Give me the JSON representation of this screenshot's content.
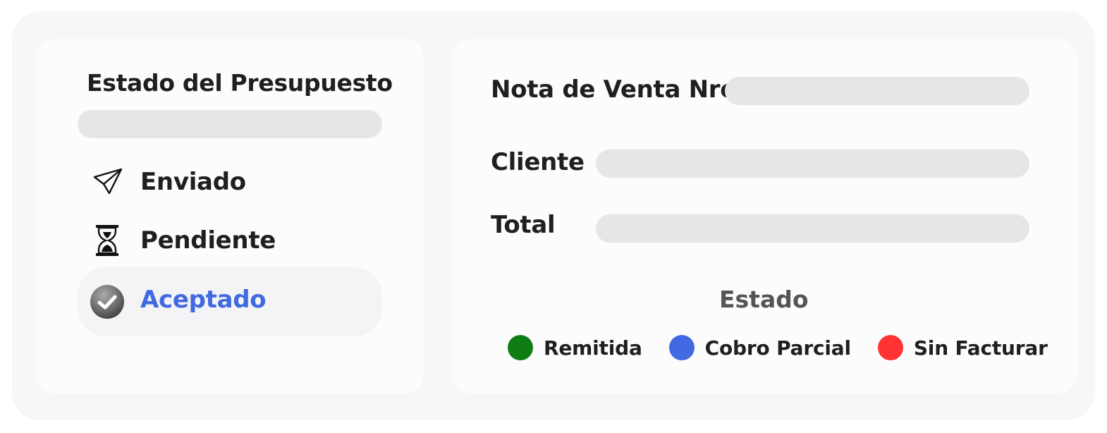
{
  "presupuesto": {
    "title": "Estado del Presupuesto",
    "statuses": [
      {
        "label": "Enviado",
        "icon": "paper-plane-icon"
      },
      {
        "label": "Pendiente",
        "icon": "hourglass-icon"
      },
      {
        "label": "Aceptado",
        "icon": "check-circle-icon",
        "active": true
      }
    ]
  },
  "venta": {
    "nota_label": "Nota de Venta Nro.",
    "nota_value": "",
    "cliente_label": "Cliente",
    "cliente_value": "",
    "total_label": "Total",
    "total_value": "",
    "estado_title": "Estado",
    "legend": [
      {
        "label": "Remitida",
        "color": "#0f7d14"
      },
      {
        "label": "Cobro Parcial",
        "color": "#4169e1"
      },
      {
        "label": "Sin Facturar",
        "color": "#ff3333"
      }
    ]
  },
  "colors": {
    "accent": "#4169e1",
    "field_bg": "#e6e6e6"
  }
}
